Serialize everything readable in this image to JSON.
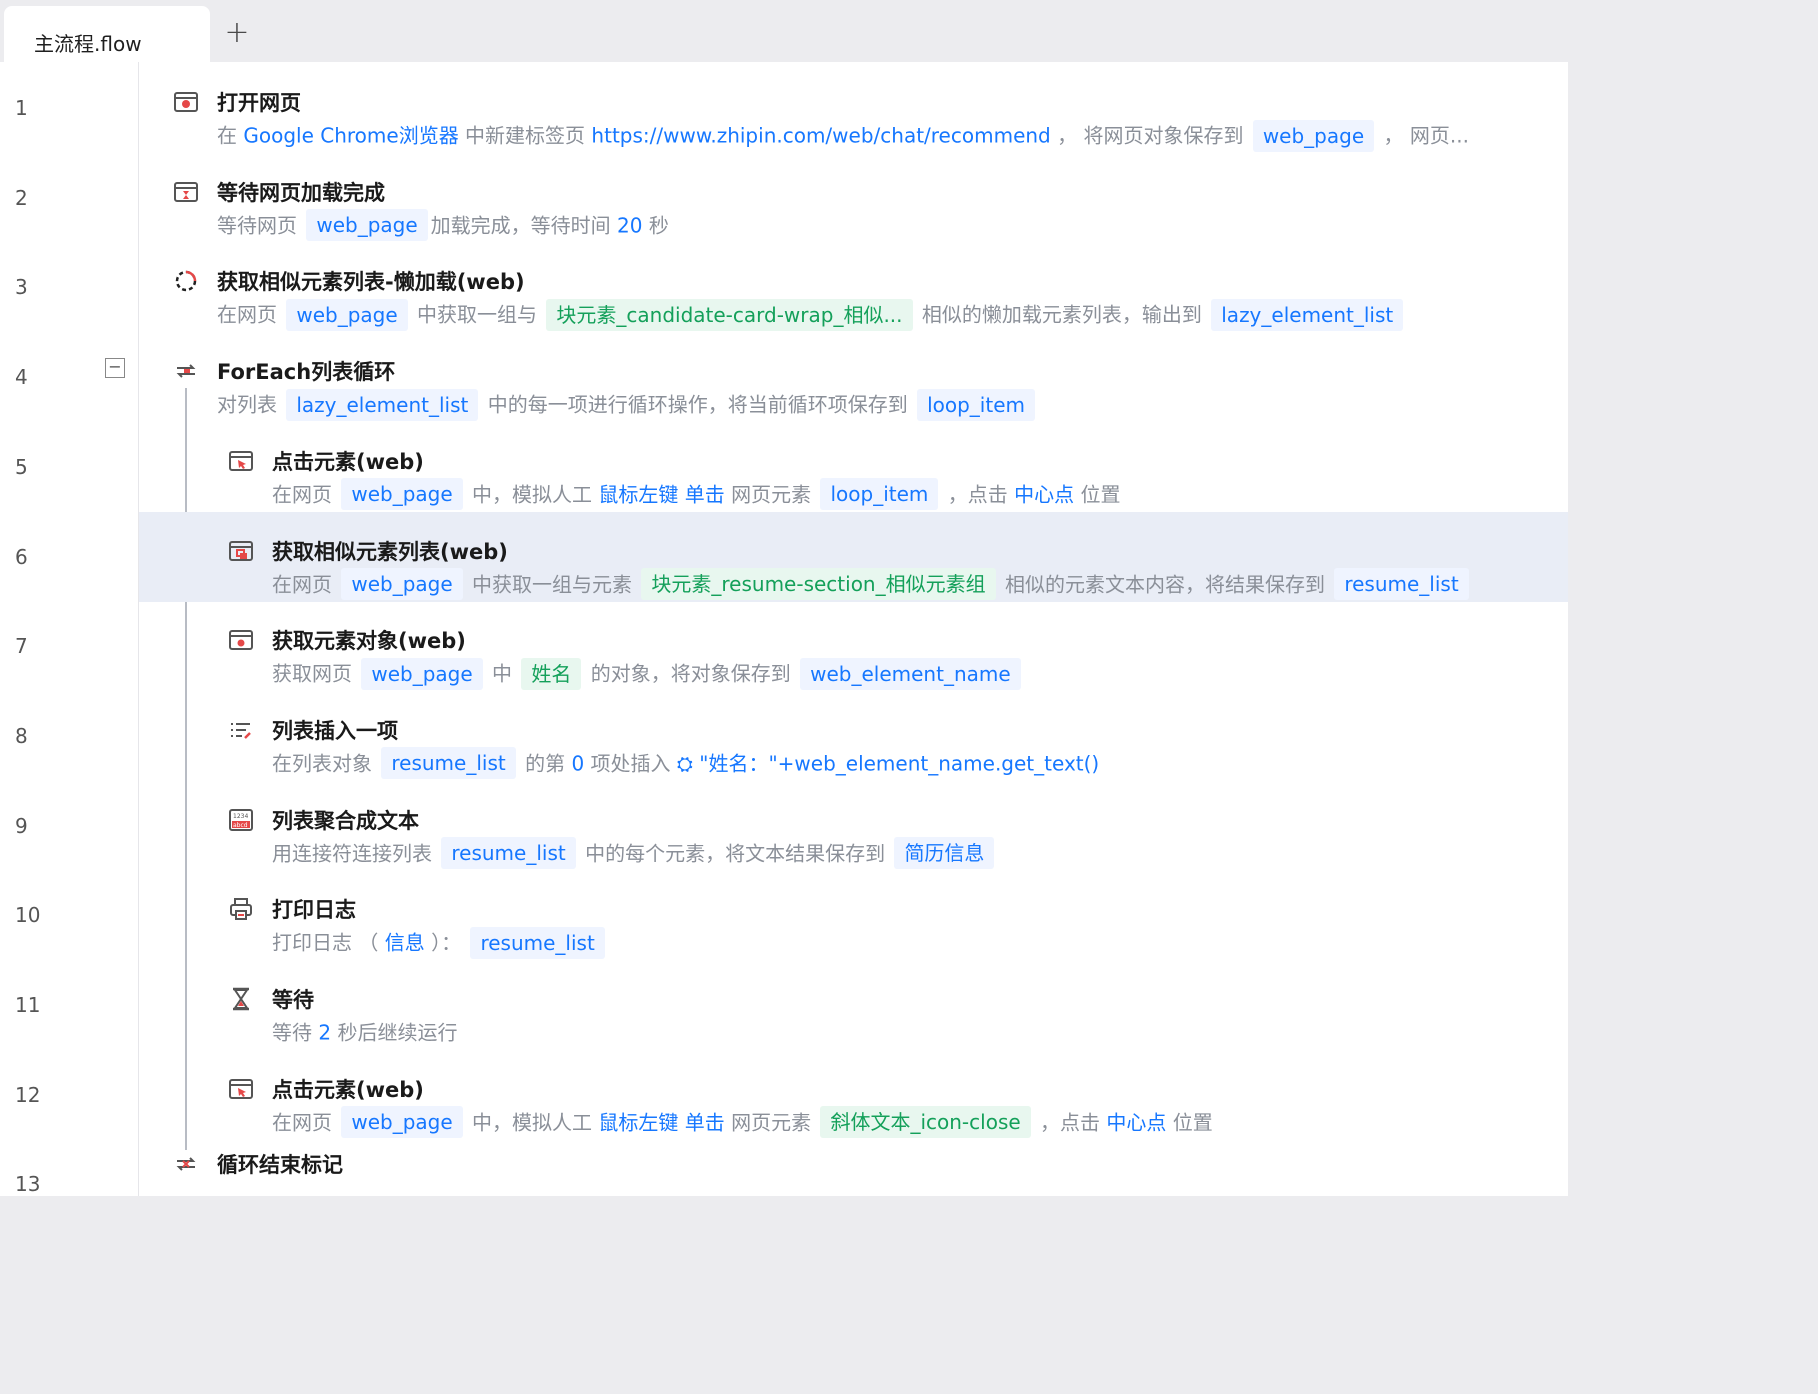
{
  "tab": {
    "label": "主流程.flow"
  },
  "add_tab": {
    "label": "+"
  },
  "collapse": {
    "label": "−"
  },
  "rows": [
    {
      "n": "1",
      "title": "打开网页",
      "desc": [
        {
          "t": "在 "
        },
        {
          "t": "Google Chrome浏览器",
          "k": "kw"
        },
        {
          "t": " 中新建标签页 "
        },
        {
          "t": "https://www.zhipin.com/web/chat/recommend",
          "k": "kw"
        },
        {
          "t": " ， 将网页对象保存到 "
        },
        {
          "t": "web_page",
          "k": "chip"
        },
        {
          "t": " ， 网页..."
        }
      ]
    },
    {
      "n": "2",
      "title": "等待网页加载完成",
      "desc": [
        {
          "t": "等待网页 "
        },
        {
          "t": "web_page",
          "k": "chip"
        },
        {
          "t": "加载完成，等待时间 "
        },
        {
          "t": "20",
          "k": "kw"
        },
        {
          "t": " 秒"
        }
      ]
    },
    {
      "n": "3",
      "title": "获取相似元素列表-懒加载(web)",
      "desc": [
        {
          "t": "在网页 "
        },
        {
          "t": "web_page",
          "k": "chip"
        },
        {
          "t": " 中获取一组与 "
        },
        {
          "t": "块元素_candidate-card-wrap_相似...",
          "k": "green"
        },
        {
          "t": " 相似的懒加载元素列表，输出到 "
        },
        {
          "t": "lazy_element_list",
          "k": "chip"
        }
      ]
    },
    {
      "n": "4",
      "title": "ForEach列表循环",
      "desc": [
        {
          "t": "对列表 "
        },
        {
          "t": "lazy_element_list",
          "k": "chip"
        },
        {
          "t": " 中的每一项进行循环操作，将当前循环项保存到 "
        },
        {
          "t": "loop_item",
          "k": "chip"
        }
      ]
    },
    {
      "n": "5",
      "title": "点击元素(web)",
      "desc": [
        {
          "t": "在网页 "
        },
        {
          "t": "web_page",
          "k": "chip"
        },
        {
          "t": " 中，模拟人工 "
        },
        {
          "t": "鼠标左键",
          "k": "kw"
        },
        {
          "t": " "
        },
        {
          "t": "单击",
          "k": "kw"
        },
        {
          "t": " 网页元素 "
        },
        {
          "t": "loop_item",
          "k": "chip"
        },
        {
          "t": " ，点击 "
        },
        {
          "t": "中心点",
          "k": "kw"
        },
        {
          "t": " 位置"
        }
      ]
    },
    {
      "n": "6",
      "title": "获取相似元素列表(web)",
      "desc": [
        {
          "t": "在网页 "
        },
        {
          "t": "web_page",
          "k": "chip"
        },
        {
          "t": " 中获取一组与元素 "
        },
        {
          "t": "块元素_resume-section_相似元素组",
          "k": "green"
        },
        {
          "t": " 相似的元素文本内容，将结果保存到 "
        },
        {
          "t": "resume_list",
          "k": "chip"
        }
      ]
    },
    {
      "n": "7",
      "title": "获取元素对象(web)",
      "desc": [
        {
          "t": "获取网页 "
        },
        {
          "t": "web_page",
          "k": "chip"
        },
        {
          "t": " 中 "
        },
        {
          "t": "姓名",
          "k": "green"
        },
        {
          "t": " 的对象，将对象保存到 "
        },
        {
          "t": "web_element_name",
          "k": "chip"
        }
      ]
    },
    {
      "n": "8",
      "title": "列表插入一项",
      "desc": [
        {
          "t": "在列表对象 "
        },
        {
          "t": "resume_list",
          "k": "chip"
        },
        {
          "t": " 的第 "
        },
        {
          "t": "0",
          "k": "kw"
        },
        {
          "t": " 项处插入 "
        },
        {
          "t": "⛭ \"姓名：\"+web_element_name.get_text()",
          "k": "kw"
        }
      ]
    },
    {
      "n": "9",
      "title": "列表聚合成文本",
      "desc": [
        {
          "t": "用连接符连接列表 "
        },
        {
          "t": "resume_list",
          "k": "chip"
        },
        {
          "t": " 中的每个元素，将文本结果保存到 "
        },
        {
          "t": "简历信息",
          "k": "chip"
        }
      ]
    },
    {
      "n": "10",
      "title": "打印日志",
      "desc": [
        {
          "t": "打印日志 （ "
        },
        {
          "t": "信息",
          "k": "kw"
        },
        {
          "t": " ）： "
        },
        {
          "t": "resume_list",
          "k": "chip"
        }
      ]
    },
    {
      "n": "11",
      "title": "等待",
      "desc": [
        {
          "t": "等待 "
        },
        {
          "t": "2",
          "k": "kw"
        },
        {
          "t": " 秒后继续运行"
        }
      ]
    },
    {
      "n": "12",
      "title": "点击元素(web)",
      "desc": [
        {
          "t": "在网页 "
        },
        {
          "t": "web_page",
          "k": "chip"
        },
        {
          "t": " 中，模拟人工 "
        },
        {
          "t": "鼠标左键",
          "k": "kw"
        },
        {
          "t": " "
        },
        {
          "t": "单击",
          "k": "kw"
        },
        {
          "t": " 网页元素 "
        },
        {
          "t": "斜体文本_icon-close",
          "k": "green"
        },
        {
          "t": " ，点击 "
        },
        {
          "t": "中心点",
          "k": "kw"
        },
        {
          "t": " 位置"
        }
      ]
    },
    {
      "n": "13",
      "title": "循环结束标记",
      "desc": []
    }
  ],
  "icons": [
    "browser-open-icon",
    "browser-wait-icon",
    "loading-spinner-icon",
    "loop-icon",
    "click-element-icon",
    "similar-elements-icon",
    "element-object-icon",
    "list-insert-icon",
    "list-join-icon",
    "print-log-icon",
    "hourglass-icon",
    "click-element-icon",
    "loop-end-icon"
  ],
  "colors": {
    "accent": "#1677ff",
    "green": "#14a05a",
    "selected_row": "#e9edf6"
  }
}
